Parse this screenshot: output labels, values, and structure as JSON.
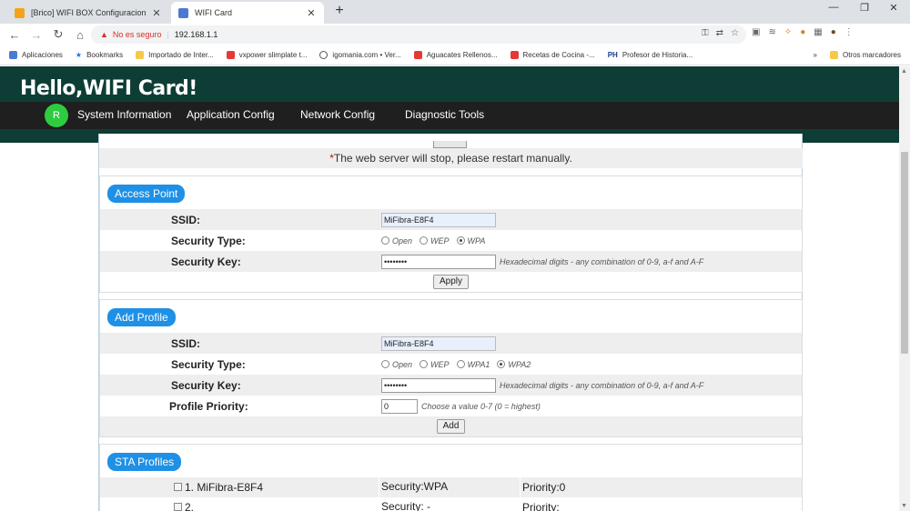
{
  "tabs": [
    {
      "title": "[Brico] WIFI BOX Configuracion",
      "favicon_color": "#f4a21c"
    },
    {
      "title": "WIFI Card",
      "favicon_color": "#4a7bd0"
    }
  ],
  "omnibox": {
    "security_warning": "No es seguro",
    "url": "192.168.1.1"
  },
  "bookmarks": [
    {
      "label": "Aplicaciones",
      "icon": "grid-icon"
    },
    {
      "label": "Bookmarks",
      "icon": "star-icon"
    },
    {
      "label": "Importado de Inter...",
      "icon": "folder-icon"
    },
    {
      "label": "vxpower slimplate t...",
      "icon": "youtube-icon"
    },
    {
      "label": "igomania.com • Ver...",
      "icon": "globe-icon"
    },
    {
      "label": "Aguacates Rellenos...",
      "icon": "youtube-icon"
    },
    {
      "label": "Recetas de Cocina -...",
      "icon": "youtube-icon"
    },
    {
      "label": "Profesor de Historia...",
      "icon": "ph-icon",
      "prefix": "PH"
    }
  ],
  "bookmarks_more": "»",
  "other_bookmarks": "Otros marcadores",
  "header": {
    "title": "Hello,WIFI Card!",
    "avatar_letter": "R"
  },
  "nav": [
    "System Information",
    "Application Config",
    "Network Config",
    "Diagnostic Tools"
  ],
  "warning": {
    "asterisk": "*",
    "text": "The web server will stop, please restart manually."
  },
  "access_point": {
    "heading": "Access Point",
    "ssid_label": "SSID:",
    "ssid_value": "MiFibra-E8F4",
    "security_type_label": "Security Type:",
    "security_options": [
      "Open",
      "WEP",
      "WPA"
    ],
    "security_selected": "WPA",
    "security_key_label": "Security Key:",
    "security_key_value": "••••••••",
    "key_hint": "Hexadecimal digits - any combination of 0-9, a-f and A-F",
    "apply_label": "Apply"
  },
  "add_profile": {
    "heading": "Add Profile",
    "ssid_label": "SSID:",
    "ssid_value": "MiFibra-E8F4",
    "security_type_label": "Security Type:",
    "security_options": [
      "Open",
      "WEP",
      "WPA1",
      "WPA2"
    ],
    "security_selected": "WPA2",
    "security_key_label": "Security Key:",
    "security_key_value": "••••••••",
    "key_hint": "Hexadecimal digits - any combination of 0-9, a-f and A-F",
    "priority_label": "Profile Priority:",
    "priority_value": "0",
    "priority_hint": "Choose a value 0-7 (0 = highest)",
    "add_label": "Add"
  },
  "sta_profiles": {
    "heading": "STA Profiles",
    "rows": [
      {
        "name": "1. MiFibra-E8F4",
        "security": "Security:WPA",
        "priority": "Priority:0"
      },
      {
        "name": "2.",
        "security": "Security: -",
        "priority": "Priority:"
      }
    ]
  }
}
